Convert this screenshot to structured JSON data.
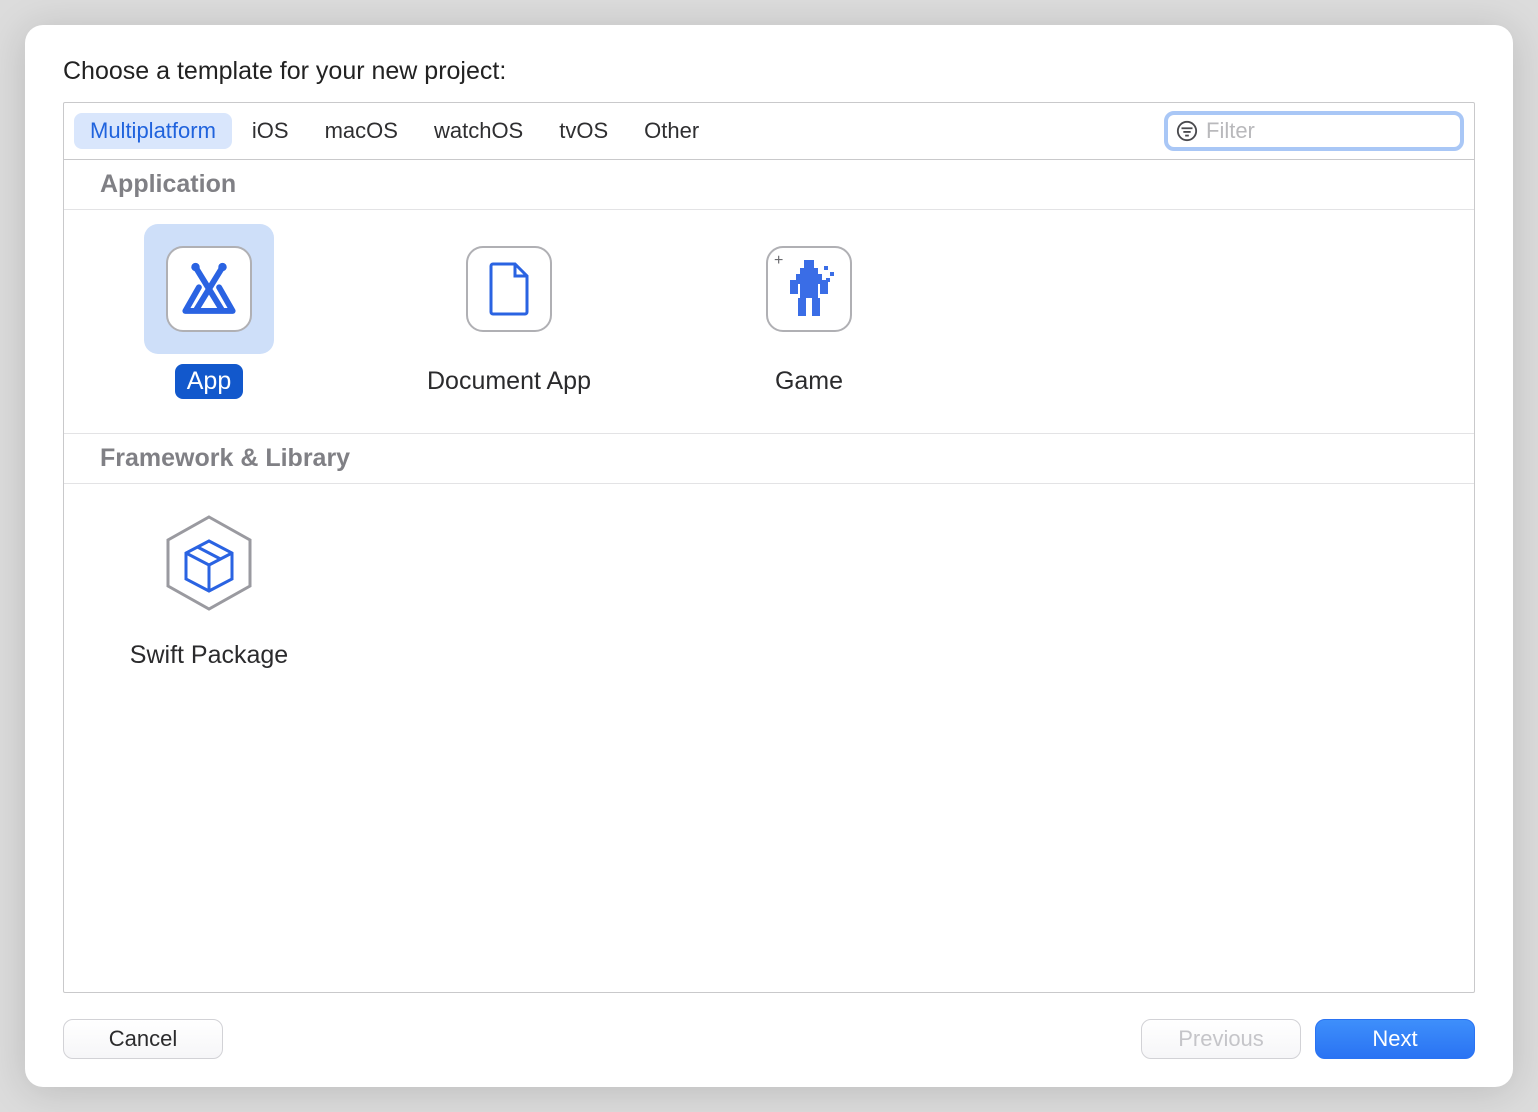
{
  "title": "Choose a template for your new project:",
  "tabs": [
    "Multiplatform",
    "iOS",
    "macOS",
    "watchOS",
    "tvOS",
    "Other"
  ],
  "active_tab": 0,
  "filter": {
    "placeholder": "Filter",
    "value": ""
  },
  "sections": [
    {
      "title": "Application",
      "templates": [
        {
          "name": "App",
          "icon": "app-icon",
          "selected": true
        },
        {
          "name": "Document App",
          "icon": "document-icon",
          "selected": false
        },
        {
          "name": "Game",
          "icon": "game-icon",
          "selected": false
        }
      ]
    },
    {
      "title": "Framework & Library",
      "templates": [
        {
          "name": "Swift Package",
          "icon": "package-icon",
          "selected": false
        }
      ]
    }
  ],
  "buttons": {
    "cancel": "Cancel",
    "previous": "Previous",
    "next": "Next"
  }
}
